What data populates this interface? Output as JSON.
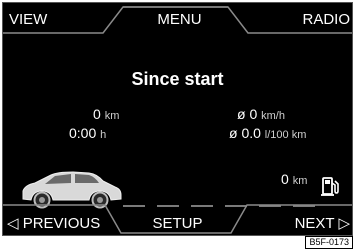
{
  "top_nav": {
    "left_label": "VIEW",
    "center_label": "MENU",
    "right_label": "RADIO"
  },
  "trip": {
    "title": "Since start",
    "distance": {
      "value": "0",
      "unit": "km"
    },
    "time": {
      "value": "0:00",
      "unit": "h"
    },
    "avg_speed": {
      "value": "ø 0",
      "unit": "km/h"
    },
    "avg_consumption": {
      "value": "ø 0.0",
      "unit": "l/100 km"
    }
  },
  "range": {
    "value": "0",
    "unit": "km"
  },
  "bottom_nav": {
    "left_label": "◁ PREVIOUS",
    "center_label": "SETUP",
    "right_label": "NEXT ▷"
  },
  "figure_ref": "B5F-0173",
  "icons": {
    "car": "car-side-icon",
    "fuel": "fuel-pump-icon"
  },
  "colors": {
    "background": "#000000",
    "text": "#ffffff",
    "frame": "#5a5a5a"
  }
}
